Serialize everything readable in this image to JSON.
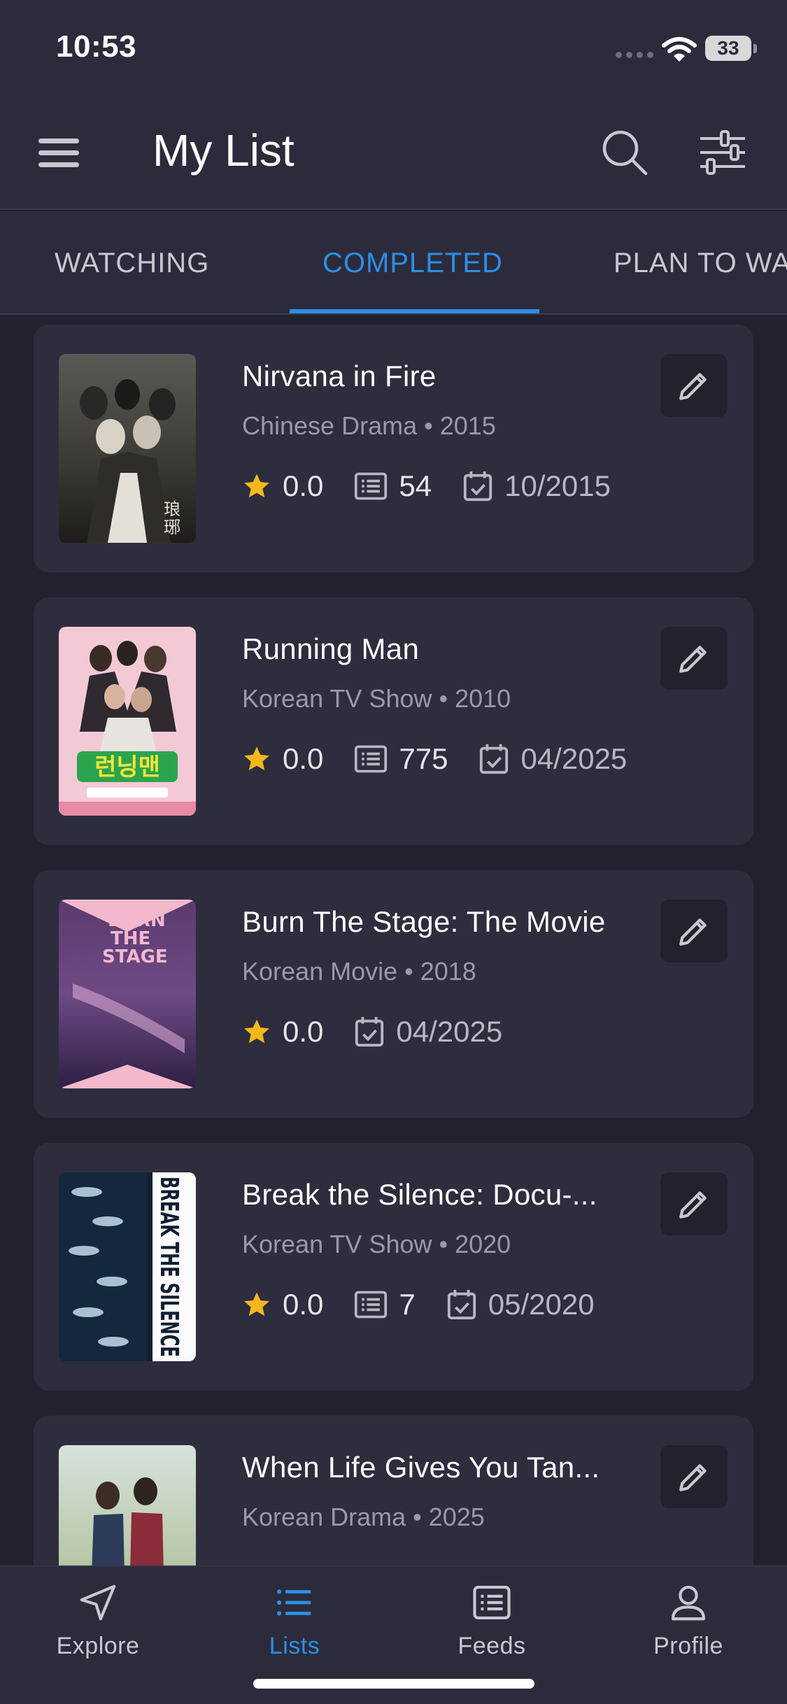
{
  "status_bar": {
    "time": "10:53",
    "battery": "33"
  },
  "header": {
    "title": "My List"
  },
  "tabs": [
    {
      "label": "WATCHING"
    },
    {
      "label": "COMPLETED"
    },
    {
      "label": "PLAN TO WATCH"
    }
  ],
  "items": [
    {
      "title": "Nirvana in Fire",
      "meta": "Chinese Drama • 2015",
      "rating": "0.0",
      "episodes": "54",
      "date": "10/2015"
    },
    {
      "title": "Running Man",
      "meta": "Korean TV Show • 2010",
      "rating": "0.0",
      "episodes": "775",
      "date": "04/2025"
    },
    {
      "title": "Burn The Stage: The Movie",
      "meta": "Korean Movie • 2018",
      "rating": "0.0",
      "date": "04/2025"
    },
    {
      "title": "Break the Silence: Docu-...",
      "meta": "Korean TV Show • 2020",
      "rating": "0.0",
      "episodes": "7",
      "date": "05/2020"
    },
    {
      "title": "When Life Gives You Tan...",
      "meta": "Korean Drama • 2025"
    }
  ],
  "posters": {
    "running_man_text": "런닝맨",
    "burn_the_stage_lines": [
      "BURN",
      "THE",
      "STAGE"
    ],
    "break_the_silence_text": "BREAK THE SILENCE"
  },
  "bottom_nav": [
    {
      "label": "Explore"
    },
    {
      "label": "Lists"
    },
    {
      "label": "Feeds"
    },
    {
      "label": "Profile"
    }
  ],
  "colors": {
    "accent": "#2d8fe6",
    "star": "#f5b81c",
    "background": "#22222f",
    "card": "#2d2d3e"
  },
  "icons": [
    "menu-icon",
    "search-icon",
    "filter-icon",
    "star-icon",
    "episodes-icon",
    "calendar-check-icon",
    "pencil-icon",
    "navigation-icon",
    "list-icon",
    "feed-icon",
    "person-icon"
  ]
}
